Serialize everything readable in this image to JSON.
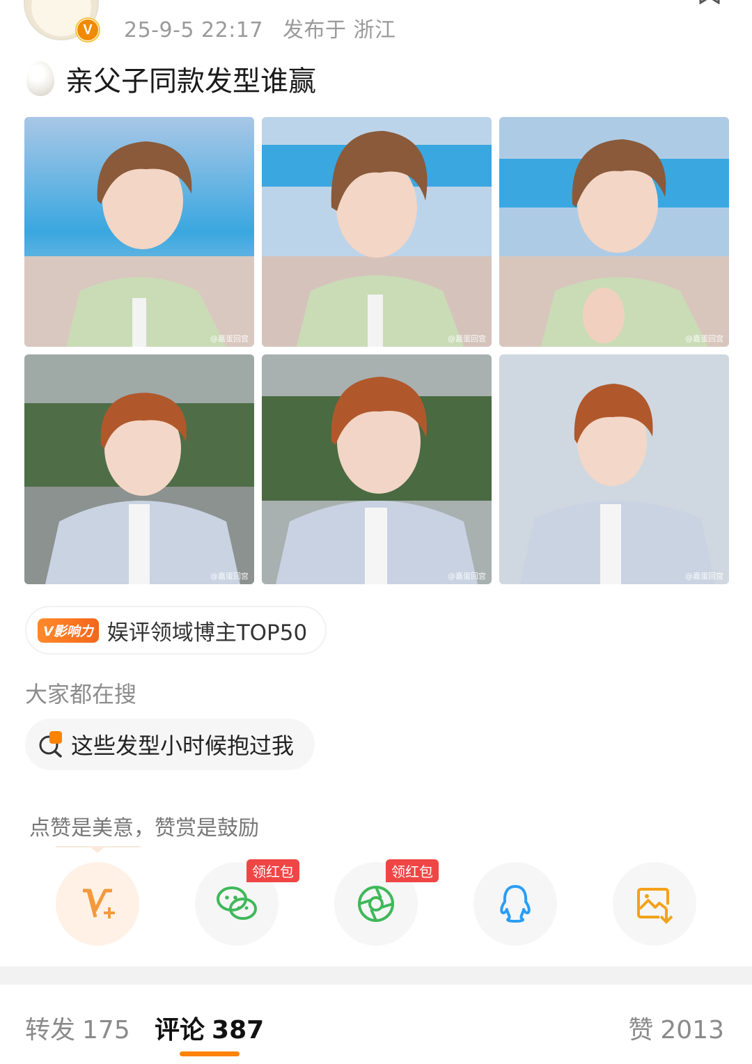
{
  "header": {
    "date": "25-9-5 22:17",
    "location_prefix": "发布于",
    "location": "浙江",
    "verified_badge": "V"
  },
  "post": {
    "text": "亲父子同款发型谁赢",
    "emoji": "egg-emoji"
  },
  "images": [
    {
      "label": "photo-1",
      "watermark": "@嘉蛋回宫"
    },
    {
      "label": "photo-2",
      "watermark": "@嘉蛋回宫"
    },
    {
      "label": "photo-3",
      "watermark": "@嘉蛋回宫"
    },
    {
      "label": "photo-4",
      "watermark": "@嘉蛋回宫"
    },
    {
      "label": "photo-5",
      "watermark": "@嘉蛋回宫"
    },
    {
      "label": "photo-6",
      "watermark": "@嘉蛋回宫"
    }
  ],
  "influence": {
    "badge": "V影响力",
    "text": "娱评领域博主TOP50"
  },
  "search": {
    "heading": "大家都在搜",
    "chip": "这些发型小时候抱过我"
  },
  "reward": {
    "text": "点赞是美意，赞赏是鼓励"
  },
  "share": {
    "buttons": [
      {
        "name": "reward-v-plus",
        "icon": "v-plus-icon",
        "color": "#f39a3c"
      },
      {
        "name": "wechat",
        "icon": "wechat-icon",
        "color": "#3fb85a",
        "tag": "领红包"
      },
      {
        "name": "moments",
        "icon": "moments-icon",
        "color": "#3fb85a",
        "tag": "领红包"
      },
      {
        "name": "qq",
        "icon": "qq-icon",
        "color": "#2a9df4"
      },
      {
        "name": "save-image",
        "icon": "save-image-icon",
        "color": "#f3a21a"
      }
    ]
  },
  "tabs": {
    "repost_label": "转发",
    "repost_count": "175",
    "comment_label": "评论",
    "comment_count": "387",
    "like_label": "赞",
    "like_count": "2013",
    "accent": "#ff8200"
  }
}
